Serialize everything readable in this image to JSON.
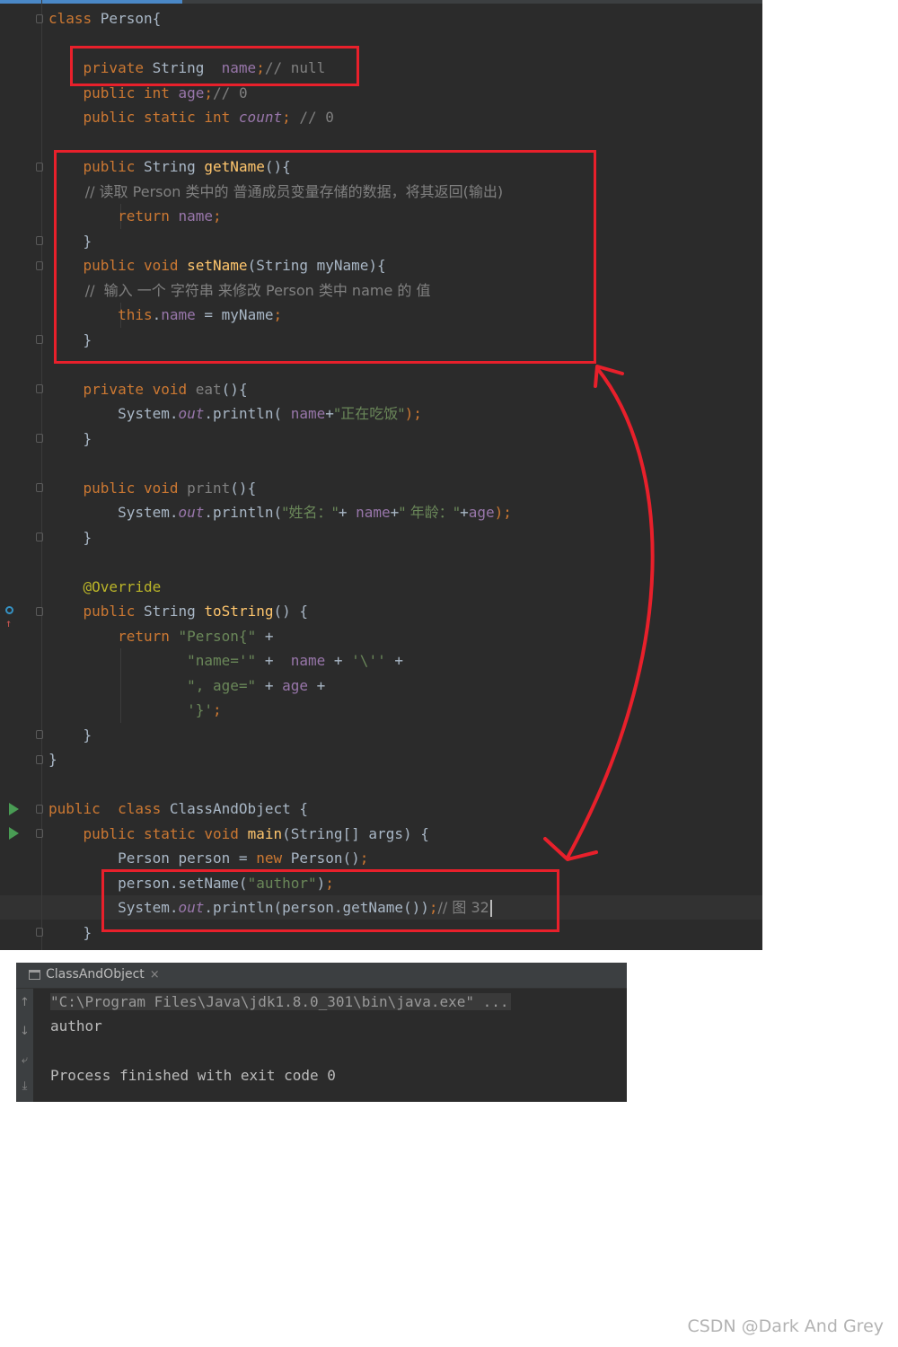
{
  "editor": {
    "lines": [
      {
        "segments": [
          {
            "t": "class ",
            "c": "kw"
          },
          {
            "t": "Person{",
            "c": ""
          }
        ]
      },
      {
        "segments": []
      },
      {
        "segments": [
          {
            "t": "    private ",
            "c": "kw"
          },
          {
            "t": "String  ",
            "c": ""
          },
          {
            "t": "name",
            "c": "fld"
          },
          {
            "t": ";",
            "c": "kw"
          },
          {
            "t": "// null",
            "c": "cmt"
          }
        ]
      },
      {
        "segments": [
          {
            "t": "    public int ",
            "c": "kw"
          },
          {
            "t": "age",
            "c": "fld"
          },
          {
            "t": ";",
            "c": "kw"
          },
          {
            "t": "// 0",
            "c": "cmt"
          }
        ]
      },
      {
        "segments": [
          {
            "t": "    public static int ",
            "c": "kw"
          },
          {
            "t": "count",
            "c": "sfld"
          },
          {
            "t": "; ",
            "c": "kw"
          },
          {
            "t": "// 0",
            "c": "cmt"
          }
        ]
      },
      {
        "segments": []
      },
      {
        "segments": [
          {
            "t": "    public ",
            "c": "kw"
          },
          {
            "t": "String ",
            "c": ""
          },
          {
            "t": "getName",
            "c": "fn"
          },
          {
            "t": "(){",
            "c": ""
          }
        ]
      },
      {
        "segments": [
          {
            "t": "        // 读取 Person 类中的 普通成员变量存储的数据，将其返回(输出)",
            "c": "cmt"
          }
        ]
      },
      {
        "segments": [
          {
            "t": "        return ",
            "c": "kw"
          },
          {
            "t": "name",
            "c": "fld"
          },
          {
            "t": ";",
            "c": "kw"
          }
        ]
      },
      {
        "segments": [
          {
            "t": "    }",
            "c": ""
          }
        ]
      },
      {
        "segments": [
          {
            "t": "    public void ",
            "c": "kw"
          },
          {
            "t": "setName",
            "c": "fn"
          },
          {
            "t": "(String myName){",
            "c": ""
          }
        ]
      },
      {
        "segments": [
          {
            "t": "        //  输入 一个 字符串 来修改 Person 类中 name 的 值",
            "c": "cmt"
          }
        ]
      },
      {
        "segments": [
          {
            "t": "        this",
            "c": "kw"
          },
          {
            "t": ".",
            "c": ""
          },
          {
            "t": "name",
            "c": "fld"
          },
          {
            "t": " = myName",
            "c": ""
          },
          {
            "t": ";",
            "c": "kw"
          }
        ]
      },
      {
        "segments": [
          {
            "t": "    }",
            "c": ""
          }
        ]
      },
      {
        "segments": []
      },
      {
        "segments": [
          {
            "t": "    private void ",
            "c": "kw"
          },
          {
            "t": "eat",
            "c": "grey"
          },
          {
            "t": "(){",
            "c": ""
          }
        ]
      },
      {
        "segments": [
          {
            "t": "        System.",
            "c": ""
          },
          {
            "t": "out",
            "c": "sfld"
          },
          {
            "t": ".println( ",
            "c": ""
          },
          {
            "t": "name",
            "c": "fld"
          },
          {
            "t": "+",
            "c": ""
          },
          {
            "t": "\"正在吃饭\"",
            "c": "str"
          },
          {
            "t": ");",
            "c": "kw"
          }
        ]
      },
      {
        "segments": [
          {
            "t": "    }",
            "c": ""
          }
        ]
      },
      {
        "segments": []
      },
      {
        "segments": [
          {
            "t": "    public void ",
            "c": "kw"
          },
          {
            "t": "print",
            "c": "grey"
          },
          {
            "t": "(){",
            "c": ""
          }
        ]
      },
      {
        "segments": [
          {
            "t": "        System.",
            "c": ""
          },
          {
            "t": "out",
            "c": "sfld"
          },
          {
            "t": ".println(",
            "c": ""
          },
          {
            "t": "\"姓名：\"",
            "c": "str"
          },
          {
            "t": "+ ",
            "c": ""
          },
          {
            "t": "name",
            "c": "fld"
          },
          {
            "t": "+",
            "c": ""
          },
          {
            "t": "\" 年龄：\"",
            "c": "str"
          },
          {
            "t": "+",
            "c": ""
          },
          {
            "t": "age",
            "c": "fld"
          },
          {
            "t": ");",
            "c": "kw"
          }
        ]
      },
      {
        "segments": [
          {
            "t": "    }",
            "c": ""
          }
        ]
      },
      {
        "segments": []
      },
      {
        "segments": [
          {
            "t": "    @Override",
            "c": "ann"
          }
        ]
      },
      {
        "segments": [
          {
            "t": "    public ",
            "c": "kw"
          },
          {
            "t": "String ",
            "c": ""
          },
          {
            "t": "toString",
            "c": "fn"
          },
          {
            "t": "() {",
            "c": ""
          }
        ]
      },
      {
        "segments": [
          {
            "t": "        return ",
            "c": "kw"
          },
          {
            "t": "\"Person{\" ",
            "c": "str"
          },
          {
            "t": "+",
            "c": ""
          }
        ]
      },
      {
        "segments": [
          {
            "t": "                ",
            "c": ""
          },
          {
            "t": "\"name='\" ",
            "c": "str"
          },
          {
            "t": "+  ",
            "c": ""
          },
          {
            "t": "name ",
            "c": "fld"
          },
          {
            "t": "+ ",
            "c": ""
          },
          {
            "t": "'\\'' ",
            "c": "str"
          },
          {
            "t": "+",
            "c": ""
          }
        ]
      },
      {
        "segments": [
          {
            "t": "                ",
            "c": ""
          },
          {
            "t": "\", age=\" ",
            "c": "str"
          },
          {
            "t": "+ ",
            "c": ""
          },
          {
            "t": "age ",
            "c": "fld"
          },
          {
            "t": "+",
            "c": ""
          }
        ]
      },
      {
        "segments": [
          {
            "t": "                ",
            "c": ""
          },
          {
            "t": "'}'",
            "c": "str"
          },
          {
            "t": ";",
            "c": "kw"
          }
        ]
      },
      {
        "segments": [
          {
            "t": "    }",
            "c": ""
          }
        ]
      },
      {
        "segments": [
          {
            "t": "}",
            "c": ""
          }
        ]
      },
      {
        "segments": []
      },
      {
        "segments": [
          {
            "t": "public  class ",
            "c": "kw"
          },
          {
            "t": "ClassAndObject {",
            "c": ""
          }
        ]
      },
      {
        "segments": [
          {
            "t": "    public static void ",
            "c": "kw"
          },
          {
            "t": "main",
            "c": "fn"
          },
          {
            "t": "(String[] args) {",
            "c": ""
          }
        ]
      },
      {
        "segments": [
          {
            "t": "        Person person = ",
            "c": ""
          },
          {
            "t": "new ",
            "c": "kw"
          },
          {
            "t": "Person()",
            "c": ""
          },
          {
            "t": ";",
            "c": "kw"
          }
        ]
      },
      {
        "segments": [
          {
            "t": "        person.setName(",
            "c": ""
          },
          {
            "t": "\"author\"",
            "c": "str"
          },
          {
            "t": ")",
            "c": ""
          },
          {
            "t": ";",
            "c": "kw"
          }
        ]
      },
      {
        "segments": [
          {
            "t": "        System.",
            "c": ""
          },
          {
            "t": "out",
            "c": "sfld"
          },
          {
            "t": ".println(person.getName())",
            "c": ""
          },
          {
            "t": ";",
            "c": "kw"
          },
          {
            "t": "// 图 32",
            "c": "cmt"
          }
        ]
      },
      {
        "segments": [
          {
            "t": "    }",
            "c": ""
          }
        ]
      }
    ]
  },
  "run_panel": {
    "tab_label": "ClassAndObject",
    "tab_close": "×",
    "toolbar_icons": [
      "arrow-up-icon",
      "arrow-down-icon",
      "soft-wrap-icon",
      "scroll-to-end-icon"
    ],
    "output": [
      "\"C:\\Program Files\\Java\\jdk1.8.0_301\\bin\\java.exe\" ...",
      "author",
      "",
      "Process finished with exit code 0"
    ]
  },
  "watermark": "CSDN @Dark And Grey",
  "colors": {
    "annotation_red": "#e8202b",
    "editor_bg": "#2b2b2b",
    "keyword": "#cc7832",
    "field": "#9876aa",
    "string": "#6a8759",
    "function": "#ffc66d",
    "comment": "#808080",
    "annotation": "#bbb529"
  }
}
